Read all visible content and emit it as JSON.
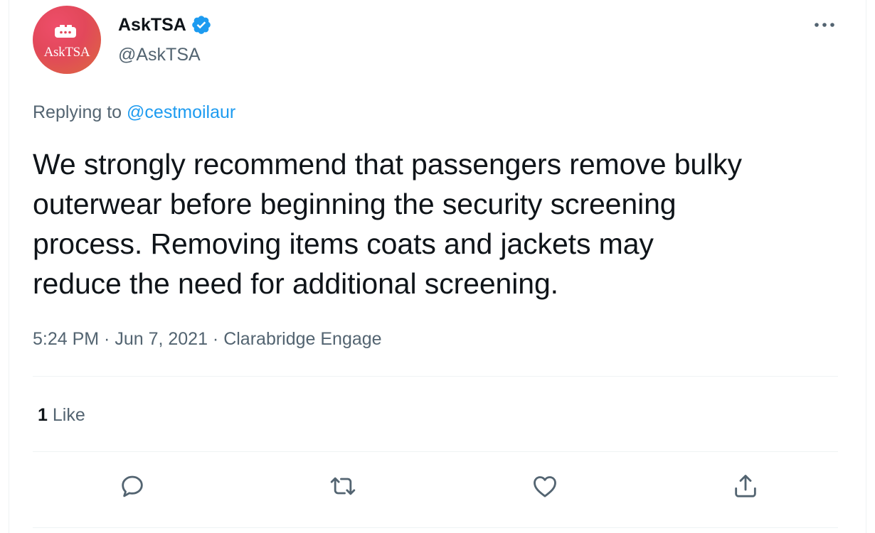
{
  "author": {
    "display_name": "AskTSA",
    "handle": "@AskTSA",
    "avatar_text": "AskTSA",
    "verified": true
  },
  "reply": {
    "prefix": "Replying to",
    "mention": "@cestmoilaur"
  },
  "tweet": {
    "lines": [
      "We strongly recommend that passengers remove bulky",
      "outerwear before beginning the security screening",
      "process. Removing items coats and jackets may",
      "reduce the need for additional screening."
    ],
    "meta": "5:24 PM · Jun 7, 2021 · Clarabridge Engage"
  },
  "stats": {
    "like_count": "1",
    "like_label": "Like"
  },
  "icons": {
    "more": "more-icon",
    "reply": "reply-icon",
    "retweet": "retweet-icon",
    "like": "like-icon",
    "share": "share-icon",
    "verified": "verified-badge-icon"
  },
  "colors": {
    "link": "#1d9bf0",
    "secondary_text": "#536471",
    "avatar": "#e2485a"
  }
}
